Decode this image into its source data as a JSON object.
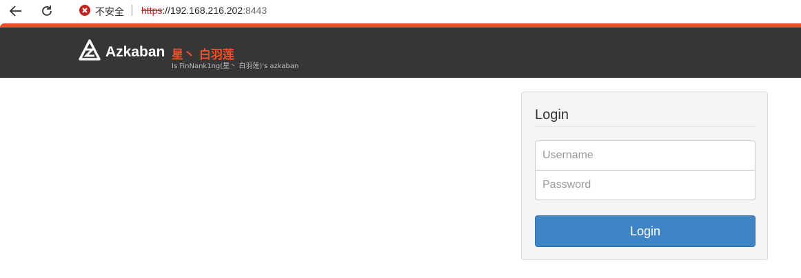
{
  "browser": {
    "security_label": "不安全",
    "url_scheme": "https",
    "url_sep": "://",
    "url_host": "192.168.216.202",
    "url_port": ":8443",
    "icons": {
      "back": "back-arrow-icon",
      "reload": "reload-icon",
      "security": "insecure-warning-icon"
    }
  },
  "header": {
    "brand_name": "Azkaban",
    "user_title": "星丶 白羽莲",
    "subtitle": "Is FinNank1ng(星丶 白羽莲)'s azkaban",
    "logo_icon": "azkaban-logo-icon"
  },
  "login": {
    "legend": "Login",
    "username_placeholder": "Username",
    "password_placeholder": "Password",
    "button_label": "Login"
  },
  "colors": {
    "accent": "#f04f29",
    "navbar": "#363636",
    "button": "#3f85c5",
    "insecure": "#c5221f"
  }
}
